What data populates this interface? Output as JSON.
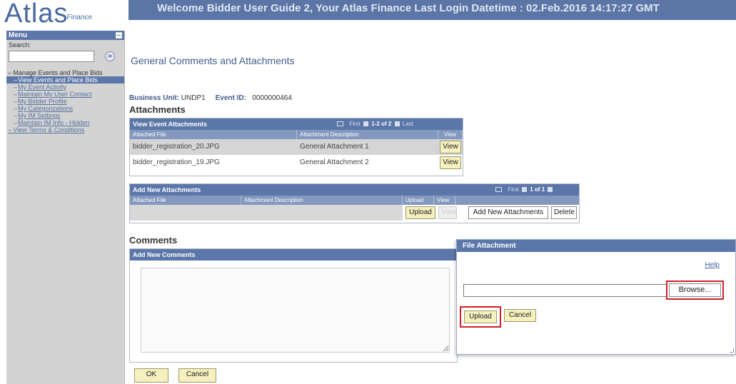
{
  "header": {
    "logo_main": "Atlas",
    "logo_sub": "Finance",
    "welcome": "Welcome Bidder User Guide 2, Your Atlas Finance Last Login Datetime : 02.Feb.2016 14:17:27 GMT"
  },
  "sidebar": {
    "menu_label": "Menu",
    "search_label": "Search:",
    "search_value": "",
    "search_go": "≫",
    "items": [
      {
        "label": "Manage Events and Place Bids"
      },
      {
        "label": "View Events and Place Bids"
      },
      {
        "label": "My Event Activity"
      },
      {
        "label": "Maintain My User Contact"
      },
      {
        "label": "My Bidder Profile"
      },
      {
        "label": "My Categorizations"
      },
      {
        "label": "My IM Settings"
      },
      {
        "label": "Maintain IM Info - Hidden"
      },
      {
        "label": "View Terms & Conditions"
      }
    ]
  },
  "main": {
    "page_title": "General Comments and Attachments",
    "business_unit_label": "Business Unit:",
    "business_unit": "UNDP1",
    "event_id_label": "Event ID:",
    "event_id": "0000000464",
    "attachments_heading": "Attachments",
    "view_grid": {
      "title": "View Event Attachments",
      "nav_first": "First",
      "nav_range": "1-2 of 2",
      "nav_last": "Last",
      "columns": [
        "Attached File",
        "Attachment Description",
        "View"
      ],
      "rows": [
        {
          "file": "bidder_registration_20.JPG",
          "description": "General Attachment 1",
          "view": "View"
        },
        {
          "file": "bidder_registration_19.JPG",
          "description": "General Attachment 2",
          "view": "View"
        }
      ]
    },
    "add_grid": {
      "title": "Add New Attachments",
      "nav_first": "First",
      "nav_range": "1 of 1",
      "columns": [
        "Attached File",
        "Attachment Description",
        "Upload",
        "View"
      ],
      "upload_label": "Upload",
      "view_label": "View",
      "add_label": "Add New Attachments",
      "delete_label": "Delete"
    },
    "comments_heading": "Comments",
    "comments_grid_title": "Add New Comments",
    "comments_value": "",
    "ok_label": "OK",
    "cancel_label": "Cancel"
  },
  "dialog": {
    "title": "File Attachment",
    "help": "Help",
    "file_value": "",
    "browse_label": "Browse...",
    "upload_label": "Upload",
    "cancel_label": "Cancel"
  },
  "colors": {
    "header_bar": "#5a75a6",
    "grid_title": "#5b76a8",
    "button_fill": "#f6efbe",
    "highlight": "#d0202a"
  }
}
